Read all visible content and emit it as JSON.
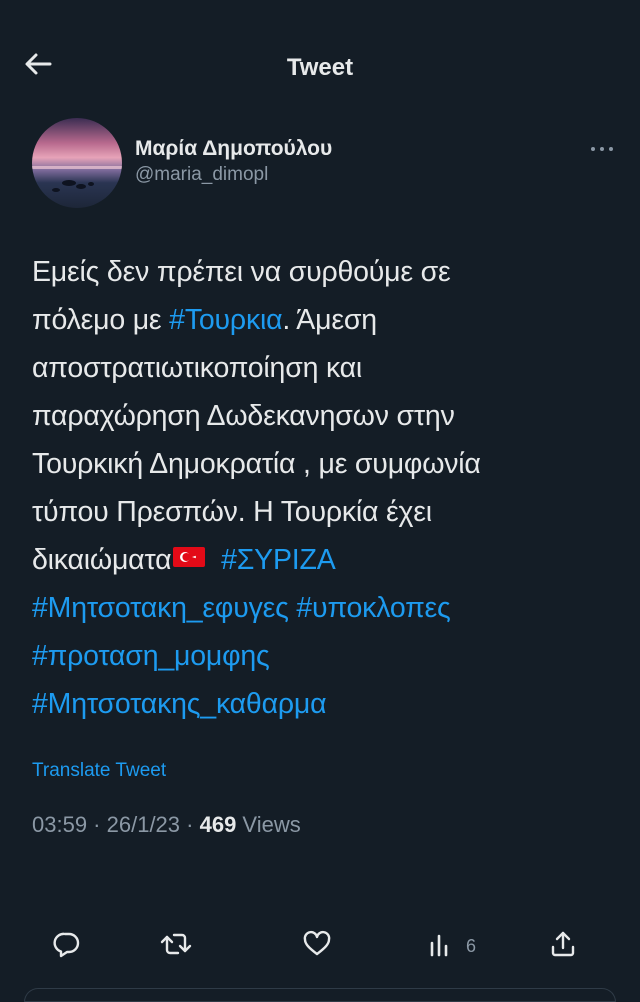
{
  "header": {
    "title": "Tweet",
    "back_icon": "arrow-left-icon"
  },
  "author": {
    "display_name": "Μαρία Δημοπούλου",
    "handle": "@maria_dimopl",
    "more_icon": "more-horizontal-icon"
  },
  "tweet": {
    "lines": [
      [
        {
          "t": "Εμείς δεν πρέπει να συρθούμε σε",
          "tag": false
        }
      ],
      [
        {
          "t": "πόλεμο με ",
          "tag": false
        },
        {
          "t": "#Τουρκια",
          "tag": true
        },
        {
          "t": ". Άμεση",
          "tag": false
        }
      ],
      [
        {
          "t": "αποστρατιωτικοποίηση και",
          "tag": false
        }
      ],
      [
        {
          "t": "παραχώρηση Δωδεκανησων στην",
          "tag": false
        }
      ],
      [
        {
          "t": "Τουρκική Δημοκρατία , με συμφωνία",
          "tag": false
        }
      ],
      [
        {
          "t": "τύπου Πρεσπών. Η Τουρκία έχει",
          "tag": false
        }
      ],
      [
        {
          "t": "δικαιώματα",
          "tag": false
        },
        {
          "flag": "turkey-flag-emoji"
        },
        {
          "t": " ",
          "tag": false
        },
        {
          "t": "#ΣΥΡΙΖΑ",
          "tag": true
        }
      ],
      [
        {
          "t": "#Μητσοτακη_εφυγες",
          "tag": true
        },
        {
          "t": " ",
          "tag": false
        },
        {
          "t": "#υποκλοπες",
          "tag": true
        }
      ],
      [
        {
          "t": "#προταση_μομφης",
          "tag": true
        }
      ],
      [
        {
          "t": "#Μητσοτακης_καθαρμα",
          "tag": true
        }
      ]
    ],
    "translate_label": "Translate Tweet",
    "time": "03:59",
    "date": "26/1/23",
    "separator": " · ",
    "views_count": "469",
    "views_label": " Views"
  },
  "actions": [
    {
      "name": "reply-button",
      "icon": "reply-icon",
      "count": ""
    },
    {
      "name": "retweet-button",
      "icon": "retweet-icon",
      "count": ""
    },
    {
      "name": "like-button",
      "icon": "heart-icon",
      "count": ""
    },
    {
      "name": "views-button",
      "icon": "analytics-icon",
      "count": "6"
    },
    {
      "name": "share-button",
      "icon": "share-icon",
      "count": ""
    }
  ],
  "colors": {
    "background": "#141d26",
    "text": "#e7e9ea",
    "secondary": "#8b98a5",
    "accent": "#1d9bf0"
  }
}
